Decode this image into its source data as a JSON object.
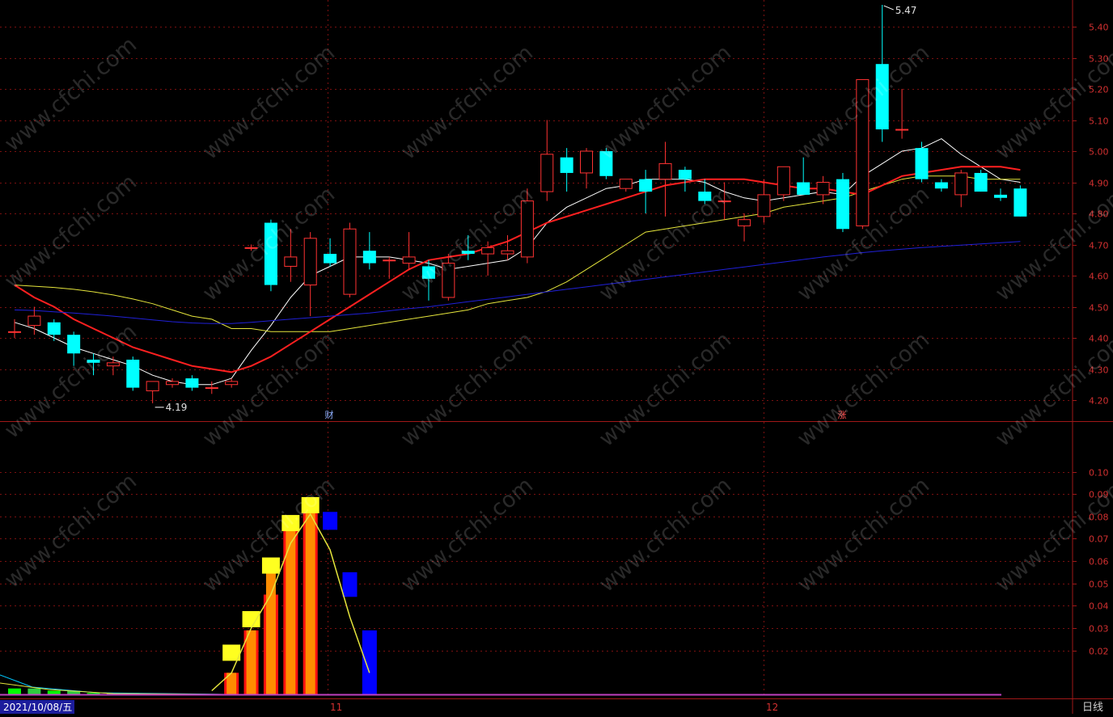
{
  "chart_data": [
    {
      "type": "candlestick",
      "y_ticks": [
        "5.40",
        "5.30",
        "5.20",
        "5.10",
        "5.00",
        "4.90",
        "4.80",
        "4.70",
        "4.60",
        "4.50",
        "4.40",
        "4.30",
        "4.20"
      ],
      "ylim": [
        4.14,
        5.5
      ],
      "annotations": {
        "high": "5.47",
        "low": "4.19"
      },
      "markers": [
        "财",
        "涨"
      ],
      "candles": [
        {
          "o": 4.42,
          "h": 4.46,
          "l": 4.4,
          "c": 4.42
        },
        {
          "o": 4.44,
          "h": 4.5,
          "l": 4.41,
          "c": 4.47
        },
        {
          "o": 4.45,
          "h": 4.46,
          "l": 4.39,
          "c": 4.41
        },
        {
          "o": 4.41,
          "h": 4.42,
          "l": 4.31,
          "c": 4.35
        },
        {
          "o": 4.33,
          "h": 4.35,
          "l": 4.28,
          "c": 4.32
        },
        {
          "o": 4.31,
          "h": 4.34,
          "l": 4.28,
          "c": 4.32
        },
        {
          "o": 4.33,
          "h": 4.34,
          "l": 4.23,
          "c": 4.24
        },
        {
          "o": 4.23,
          "h": 4.26,
          "l": 4.19,
          "c": 4.26
        },
        {
          "o": 4.25,
          "h": 4.27,
          "l": 4.24,
          "c": 4.26
        },
        {
          "o": 4.27,
          "h": 4.28,
          "l": 4.23,
          "c": 4.24
        },
        {
          "o": 4.24,
          "h": 4.26,
          "l": 4.22,
          "c": 4.24
        },
        {
          "o": 4.25,
          "h": 4.27,
          "l": 4.24,
          "c": 4.26
        },
        {
          "o": 4.69,
          "h": 4.7,
          "l": 4.68,
          "c": 4.69
        },
        {
          "o": 4.77,
          "h": 4.78,
          "l": 4.55,
          "c": 4.57
        },
        {
          "o": 4.63,
          "h": 4.75,
          "l": 4.58,
          "c": 4.66
        },
        {
          "o": 4.57,
          "h": 4.74,
          "l": 4.47,
          "c": 4.72
        },
        {
          "o": 4.67,
          "h": 4.72,
          "l": 4.63,
          "c": 4.64
        },
        {
          "o": 4.54,
          "h": 4.77,
          "l": 4.53,
          "c": 4.75
        },
        {
          "o": 4.68,
          "h": 4.74,
          "l": 4.62,
          "c": 4.64
        },
        {
          "o": 4.65,
          "h": 4.66,
          "l": 4.59,
          "c": 4.65
        },
        {
          "o": 4.64,
          "h": 4.74,
          "l": 4.62,
          "c": 4.66
        },
        {
          "o": 4.63,
          "h": 4.65,
          "l": 4.52,
          "c": 4.59
        },
        {
          "o": 4.53,
          "h": 4.67,
          "l": 4.52,
          "c": 4.64
        },
        {
          "o": 4.68,
          "h": 4.73,
          "l": 4.65,
          "c": 4.67
        },
        {
          "o": 4.67,
          "h": 4.71,
          "l": 4.6,
          "c": 4.69
        },
        {
          "o": 4.67,
          "h": 4.73,
          "l": 4.65,
          "c": 4.68
        },
        {
          "o": 4.66,
          "h": 4.88,
          "l": 4.64,
          "c": 4.84
        },
        {
          "o": 4.87,
          "h": 5.1,
          "l": 4.84,
          "c": 4.99
        },
        {
          "o": 4.98,
          "h": 5.01,
          "l": 4.87,
          "c": 4.93
        },
        {
          "o": 4.93,
          "h": 5.01,
          "l": 4.88,
          "c": 5.0
        },
        {
          "o": 5.0,
          "h": 5.01,
          "l": 4.91,
          "c": 4.92
        },
        {
          "o": 4.88,
          "h": 4.91,
          "l": 4.87,
          "c": 4.91
        },
        {
          "o": 4.91,
          "h": 4.94,
          "l": 4.8,
          "c": 4.87
        },
        {
          "o": 4.91,
          "h": 5.03,
          "l": 4.79,
          "c": 4.96
        },
        {
          "o": 4.94,
          "h": 4.95,
          "l": 4.87,
          "c": 4.91
        },
        {
          "o": 4.87,
          "h": 4.91,
          "l": 4.83,
          "c": 4.84
        },
        {
          "o": 4.84,
          "h": 4.9,
          "l": 4.78,
          "c": 4.84
        },
        {
          "o": 4.76,
          "h": 4.8,
          "l": 4.71,
          "c": 4.78
        },
        {
          "o": 4.79,
          "h": 4.91,
          "l": 4.77,
          "c": 4.86
        },
        {
          "o": 4.86,
          "h": 4.95,
          "l": 4.84,
          "c": 4.95
        },
        {
          "o": 4.9,
          "h": 4.98,
          "l": 4.87,
          "c": 4.86
        },
        {
          "o": 4.86,
          "h": 4.92,
          "l": 4.83,
          "c": 4.9
        },
        {
          "o": 4.91,
          "h": 4.93,
          "l": 4.74,
          "c": 4.75
        },
        {
          "o": 4.76,
          "h": 5.23,
          "l": 4.75,
          "c": 5.23
        },
        {
          "o": 5.28,
          "h": 5.47,
          "l": 5.03,
          "c": 5.07
        },
        {
          "o": 5.07,
          "h": 5.2,
          "l": 5.04,
          "c": 5.07
        },
        {
          "o": 5.01,
          "h": 5.03,
          "l": 4.9,
          "c": 4.91
        },
        {
          "o": 4.9,
          "h": 4.91,
          "l": 4.87,
          "c": 4.88
        },
        {
          "o": 4.86,
          "h": 4.94,
          "l": 4.82,
          "c": 4.93
        },
        {
          "o": 4.93,
          "h": 4.94,
          "l": 4.87,
          "c": 4.87
        },
        {
          "o": 4.86,
          "h": 4.88,
          "l": 4.84,
          "c": 4.85
        },
        {
          "o": 4.88,
          "h": 4.89,
          "l": 4.79,
          "c": 4.79
        }
      ],
      "series": [
        {
          "color": "#ffffff",
          "values": [
            4.45,
            4.43,
            4.4,
            4.37,
            4.35,
            4.33,
            4.31,
            4.28,
            4.26,
            4.25,
            4.25,
            4.27,
            4.36,
            4.44,
            4.53,
            4.6,
            4.63,
            4.66,
            4.66,
            4.66,
            4.65,
            4.64,
            4.62,
            4.63,
            4.64,
            4.65,
            4.69,
            4.77,
            4.82,
            4.85,
            4.88,
            4.89,
            4.91,
            4.91,
            4.91,
            4.9,
            4.87,
            4.85,
            4.84,
            4.85,
            4.86,
            4.87,
            4.86,
            4.92,
            4.96,
            5.0,
            5.01,
            5.04,
            4.99,
            4.95,
            4.91,
            4.9
          ]
        },
        {
          "color": "#e6e63c",
          "values": [
            4.57,
            4.566,
            4.562,
            4.556,
            4.548,
            4.538,
            4.525,
            4.51,
            4.49,
            4.47,
            4.46,
            4.43,
            4.43,
            4.42,
            4.42,
            4.42,
            4.42,
            4.43,
            4.44,
            4.45,
            4.46,
            4.47,
            4.48,
            4.49,
            4.51,
            4.52,
            4.53,
            4.55,
            4.58,
            4.62,
            4.66,
            4.7,
            4.74,
            4.75,
            4.76,
            4.77,
            4.78,
            4.79,
            4.8,
            4.82,
            4.83,
            4.84,
            4.85,
            4.87,
            4.89,
            4.91,
            4.92,
            4.92,
            4.92,
            4.91,
            4.91,
            4.91
          ]
        },
        {
          "color": "#ff2020",
          "values": [
            4.57,
            4.53,
            4.5,
            4.46,
            4.43,
            4.4,
            4.37,
            4.35,
            4.33,
            4.31,
            4.3,
            4.29,
            4.31,
            4.34,
            4.38,
            4.42,
            4.46,
            4.5,
            4.54,
            4.58,
            4.62,
            4.65,
            4.66,
            4.67,
            4.69,
            4.71,
            4.74,
            4.77,
            4.79,
            4.81,
            4.83,
            4.85,
            4.87,
            4.89,
            4.9,
            4.91,
            4.91,
            4.91,
            4.9,
            4.89,
            4.88,
            4.88,
            4.87,
            4.86,
            4.89,
            4.92,
            4.93,
            4.94,
            4.95,
            4.95,
            4.95,
            4.94
          ]
        },
        {
          "color": "#2020d8",
          "values": [
            4.49,
            4.488,
            4.484,
            4.48,
            4.475,
            4.47,
            4.464,
            4.458,
            4.452,
            4.448,
            4.446,
            4.446,
            4.45,
            4.455,
            4.46,
            4.465,
            4.47,
            4.475,
            4.48,
            4.487,
            4.494,
            4.5,
            4.508,
            4.516,
            4.524,
            4.532,
            4.54,
            4.548,
            4.556,
            4.564,
            4.572,
            4.58,
            4.588,
            4.596,
            4.604,
            4.612,
            4.62,
            4.628,
            4.636,
            4.644,
            4.652,
            4.66,
            4.667,
            4.674,
            4.68,
            4.685,
            4.69,
            4.694,
            4.698,
            4.702,
            4.706,
            4.71
          ]
        }
      ]
    },
    {
      "type": "bar",
      "y_ticks": [
        "0.10",
        "0.09",
        "0.08",
        "0.07",
        "0.06",
        "0.05",
        "0.04",
        "0.03",
        "0.02"
      ],
      "ylim": [
        0,
        0.113
      ],
      "bars": [
        {
          "i": 11,
          "red": 0.01,
          "orange": 0.01,
          "yellow": 0.019
        },
        {
          "i": 12,
          "red": 0.029,
          "orange": 0.029,
          "yellow": 0.034
        },
        {
          "i": 13,
          "red": 0.045,
          "orange": 0.055,
          "yellow": 0.058
        },
        {
          "i": 14,
          "red": 0.074,
          "orange": 0.08,
          "yellow": 0.077
        },
        {
          "i": 15,
          "red": 0.083,
          "orange": 0.084,
          "yellow": 0.085
        },
        {
          "i": 16,
          "blue": [
            0.074,
            0.082
          ]
        },
        {
          "i": 17,
          "blue": [
            0.044,
            0.055
          ]
        },
        {
          "i": 18,
          "blue": [
            0.0,
            0.029
          ]
        }
      ],
      "line": [
        [
          10,
          0.002
        ],
        [
          11,
          0.01
        ],
        [
          12,
          0.03
        ],
        [
          13,
          0.045
        ],
        [
          14,
          0.068
        ],
        [
          15,
          0.081
        ],
        [
          16,
          0.065
        ],
        [
          17,
          0.035
        ],
        [
          18,
          0.01
        ]
      ],
      "early_bars": [
        0.003,
        0.003,
        0.002,
        0.002,
        0.001,
        0.001,
        0.001
      ]
    }
  ],
  "x_axis": {
    "labels": [
      "2021/10/08/五",
      "11",
      "12"
    ]
  },
  "period_label": "日线",
  "watermark": "www.cfchi.com"
}
